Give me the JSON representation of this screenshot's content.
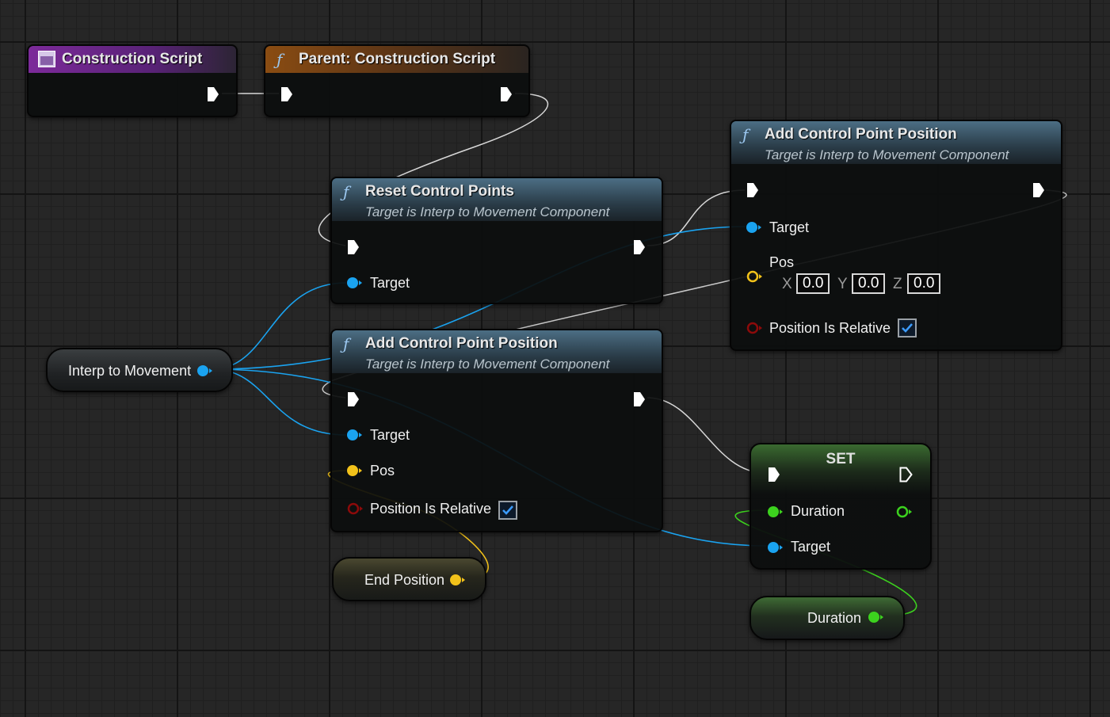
{
  "construction_script": {
    "title": "Construction Script"
  },
  "parent_construction": {
    "title": "Parent: Construction Script"
  },
  "reset_control_points": {
    "title": "Reset Control Points",
    "subtitle": "Target is Interp to Movement Component",
    "target_label": "Target"
  },
  "add_control_point_left": {
    "title": "Add Control Point Position",
    "subtitle": "Target is Interp to Movement Component",
    "target_label": "Target",
    "pos_label": "Pos",
    "relative_label": "Position Is Relative",
    "relative_checked": true
  },
  "add_control_point_right": {
    "title": "Add Control Point Position",
    "subtitle": "Target is Interp to Movement Component",
    "target_label": "Target",
    "pos_label": "Pos",
    "x_label": "X",
    "x_value": "0.0",
    "y_label": "Y",
    "y_value": "0.0",
    "z_label": "Z",
    "z_value": "0.0",
    "relative_label": "Position Is Relative",
    "relative_checked": true
  },
  "interp_to_movement": {
    "label": "Interp to Movement"
  },
  "end_position": {
    "label": "End Position"
  },
  "set_node": {
    "title": "SET",
    "duration_label": "Duration",
    "target_label": "Target"
  },
  "duration_getter": {
    "label": "Duration"
  },
  "colors": {
    "exec": "#ffffff",
    "object_pin": "#1aa3f0",
    "vector_pin": "#f2c21a",
    "bool_pin": "#8c0a0a",
    "float_pin": "#3cd21e"
  }
}
